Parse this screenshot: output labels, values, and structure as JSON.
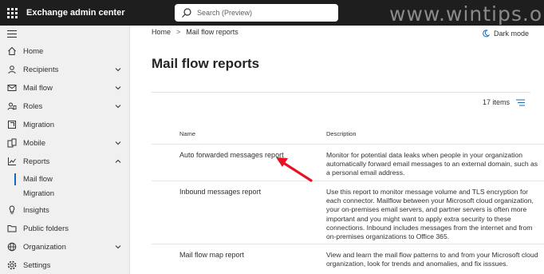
{
  "header": {
    "app_title": "Exchange admin center",
    "search_placeholder": "Search (Preview)",
    "watermark": "www.wintips.org"
  },
  "sidebar": {
    "items": [
      {
        "label": "Home",
        "icon": "home-icon",
        "expandable": false
      },
      {
        "label": "Recipients",
        "icon": "person-icon",
        "expandable": true
      },
      {
        "label": "Mail flow",
        "icon": "mail-icon",
        "expandable": true
      },
      {
        "label": "Roles",
        "icon": "roles-icon",
        "expandable": true
      },
      {
        "label": "Migration",
        "icon": "migration-icon",
        "expandable": false
      },
      {
        "label": "Mobile",
        "icon": "mobile-icon",
        "expandable": true
      },
      {
        "label": "Reports",
        "icon": "reports-icon",
        "expandable": true,
        "expanded": true
      },
      {
        "label": "Mail flow",
        "sub": true,
        "active": true
      },
      {
        "label": "Migration",
        "sub": true
      },
      {
        "label": "Insights",
        "icon": "lightbulb-icon",
        "expandable": false
      },
      {
        "label": "Public folders",
        "icon": "folder-icon",
        "expandable": false
      },
      {
        "label": "Organization",
        "icon": "globe-icon",
        "expandable": true
      },
      {
        "label": "Settings",
        "icon": "gear-icon",
        "expandable": false
      }
    ]
  },
  "breadcrumb": {
    "home": "Home",
    "current": "Mail flow reports"
  },
  "dark_mode_label": "Dark mode",
  "page_title": "Mail flow reports",
  "item_count": "17 items",
  "table": {
    "columns": [
      "Name",
      "Description"
    ],
    "rows": [
      {
        "name": "Auto forwarded messages report",
        "description": "Monitor for potential data leaks when people in your organization automatically forward email messages to an external domain, such as a personal email address."
      },
      {
        "name": "Inbound messages report",
        "description": "Use this report to monitor message volume and TLS encryption for each connector. Mailflow between your Microsoft cloud organization, your on-premises email servers, and partner servers is often more important and you might want to apply extra security to these connections. Inbound includes messages from the internet and from on-premises organizations to Office 365."
      },
      {
        "name": "Mail flow map report",
        "description": "View and learn the mail flow patterns to and from your Microsoft cloud organization, look for trends and anomalies, and fix isssues."
      }
    ]
  },
  "colors": {
    "topbar": "#1e1e1e",
    "sidebar": "#f0f0f0",
    "accent": "#0f6cbd",
    "annotation_arrow": "#e81123"
  }
}
